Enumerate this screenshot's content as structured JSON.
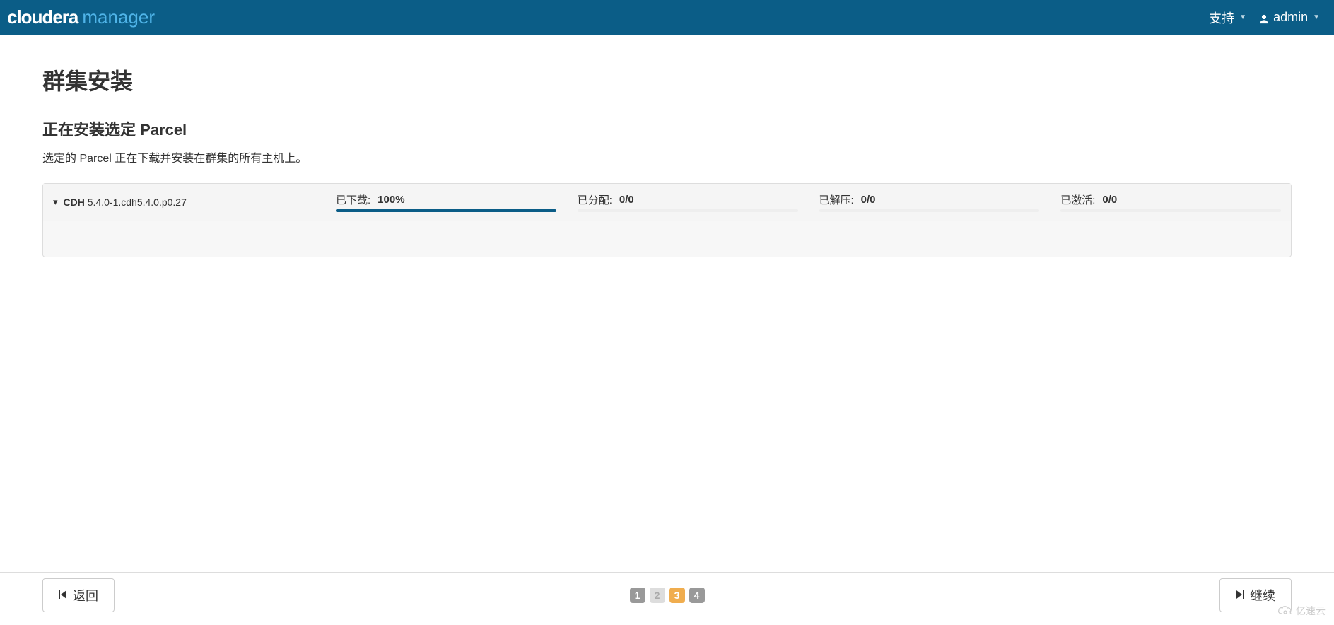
{
  "header": {
    "brand_1": "cloudera",
    "brand_2": "manager",
    "support_label": "支持",
    "user_label": "admin"
  },
  "main": {
    "title": "群集安装",
    "subtitle": "正在安装选定 Parcel",
    "description": "选定的 Parcel 正在下载并安装在群集的所有主机上。"
  },
  "parcel": {
    "name": "CDH",
    "version": "5.4.0-1.cdh5.4.0.p0.27",
    "progress": [
      {
        "label": "已下载:",
        "value": "100%",
        "percent": 100
      },
      {
        "label": "已分配:",
        "value": "0/0",
        "percent": 0
      },
      {
        "label": "已解压:",
        "value": "0/0",
        "percent": 0
      },
      {
        "label": "已激活:",
        "value": "0/0",
        "percent": 0
      }
    ]
  },
  "wizard": {
    "steps": [
      "1",
      "2",
      "3",
      "4"
    ],
    "current": 3,
    "back_label": "返回",
    "continue_label": "继续"
  },
  "watermark": {
    "text": "亿速云"
  }
}
